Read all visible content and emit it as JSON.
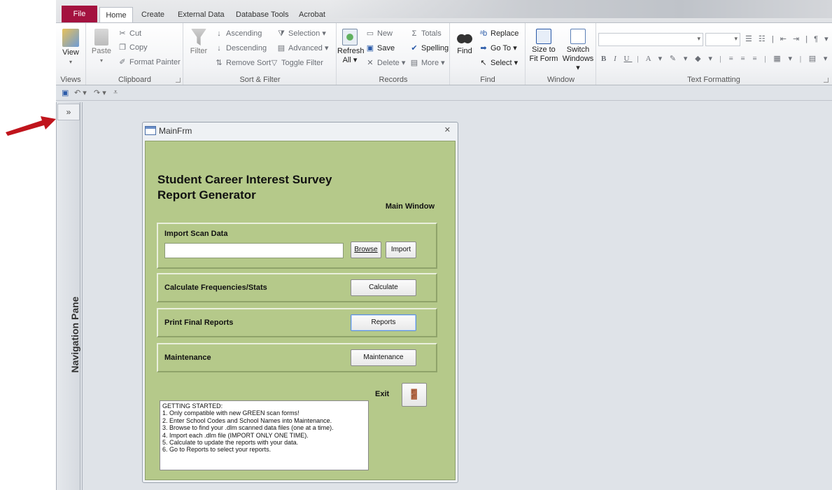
{
  "tabs": {
    "file": "File",
    "home": "Home",
    "create": "Create",
    "external_data": "External Data",
    "database_tools": "Database Tools",
    "acrobat": "Acrobat"
  },
  "ribbon": {
    "views": {
      "label": "Views",
      "view": "View"
    },
    "clipboard": {
      "label": "Clipboard",
      "paste": "Paste",
      "cut": "Cut",
      "copy": "Copy",
      "format_painter": "Format Painter"
    },
    "sort_filter": {
      "label": "Sort & Filter",
      "filter": "Filter",
      "ascending": "Ascending",
      "descending": "Descending",
      "remove_sort": "Remove Sort",
      "selection": "Selection",
      "advanced": "Advanced",
      "toggle_filter": "Toggle Filter"
    },
    "records": {
      "label": "Records",
      "refresh": "Refresh",
      "refresh2": "All",
      "new": "New",
      "save": "Save",
      "delete": "Delete",
      "totals": "Totals",
      "spelling": "Spelling",
      "more": "More"
    },
    "find": {
      "label": "Find",
      "find": "Find",
      "replace": "Replace",
      "goto": "Go To",
      "select": "Select"
    },
    "window": {
      "label": "Window",
      "size_to": "Size to",
      "fit_form": "Fit Form",
      "switch": "Switch",
      "windows": "Windows"
    },
    "text_formatting": {
      "label": "Text Formatting"
    }
  },
  "navigation_pane": {
    "toggle": "»",
    "label": "Navigation Pane"
  },
  "form": {
    "title": "MainFrm",
    "heading_line1": "Student Career Interest Survey",
    "heading_line2": "Report Generator",
    "subheading": "Main Window",
    "import": {
      "label": "Import Scan Data",
      "value": "",
      "browse": "Browse",
      "import": "Import"
    },
    "calculate": {
      "label": "Calculate Frequencies/Stats",
      "button": "Calculate"
    },
    "reports": {
      "label": "Print Final Reports",
      "button": "Reports"
    },
    "maintenance": {
      "label": "Maintenance",
      "button": "Maintenance"
    },
    "exit": "Exit",
    "notes": [
      "GETTING STARTED:",
      "1.  Only compatible with new GREEN scan forms!",
      "2.  Enter School Codes and School Names into Maintenance.",
      "3.  Browse to find your .dlm scanned data files (one at a time).",
      "4.  Import each .dlm file (IMPORT ONLY ONE TIME).",
      "5.  Calculate to update the reports with your data.",
      "6.  Go to Reports to select your reports."
    ]
  },
  "colors": {
    "file_tab": "#a4123f",
    "form_background": "#b5c98a",
    "annotation_arrow": "#c0141c"
  }
}
